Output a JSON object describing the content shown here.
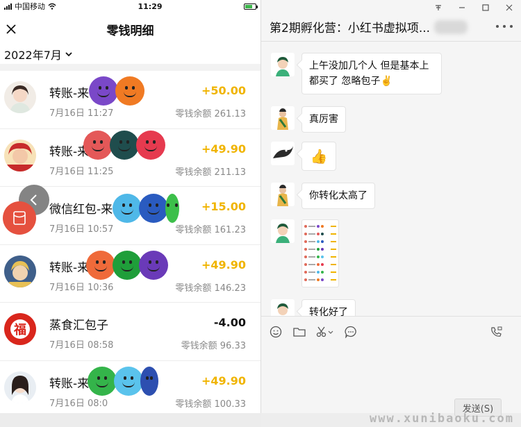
{
  "status_bar": {
    "carrier": "中国移动",
    "time": "11:29"
  },
  "nav": {
    "title": "零钱明细"
  },
  "month": {
    "label": "2022年7月"
  },
  "transactions": [
    {
      "title": "转账-来",
      "date": "7月16日 11:27",
      "amount": "+50.00",
      "balance": "零钱余额 261.13"
    },
    {
      "title": "转账-来",
      "date": "7月16日 11:25",
      "amount": "+49.90",
      "balance": "零钱余额 211.13"
    },
    {
      "title": "微信红包-来",
      "date": "7月16日 10:57",
      "amount": "+15.00",
      "balance": "零钱余额 161.23"
    },
    {
      "title": "转账-来自",
      "date": "7月16日 10:36",
      "amount": "+49.90",
      "balance": "零钱余额 146.23"
    },
    {
      "title": "蒸食汇包子",
      "date": "7月16日 08:58",
      "amount": "-4.00",
      "balance": "零钱余额 96.33"
    },
    {
      "title": "转账-来",
      "date": "7月16日 08:0",
      "amount": "+49.90",
      "balance": "零钱余额 100.33"
    }
  ],
  "avatar_badge": {
    "text": "福"
  },
  "chat": {
    "title": "第2期孵化营：小红书虚拟项...",
    "window_controls": [
      "pin-icon",
      "minimize-icon",
      "maximize-icon",
      "close-icon"
    ],
    "messages": [
      {
        "text": "上午没加几个人 但是基本上都买了 忽略包子✌️"
      },
      {
        "text": "真厉害"
      },
      {
        "text": "👍"
      },
      {
        "text": "你转化太高了"
      },
      {
        "text": ""
      },
      {
        "text": "转化好了"
      }
    ],
    "send_label": "发送(S)"
  },
  "watermark": "www.xunibaoku.com",
  "colors": {
    "income": "#f0b400",
    "expense": "#111111",
    "red_packet": "#e5513f"
  }
}
